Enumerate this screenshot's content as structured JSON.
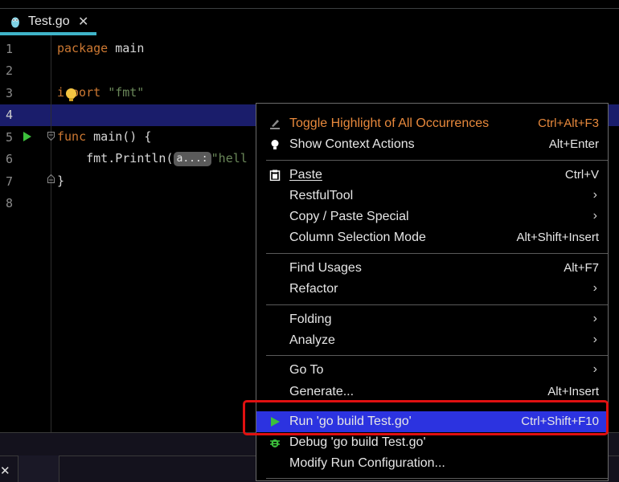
{
  "tab": {
    "name": "Test.go",
    "close": "✕"
  },
  "editor": {
    "line_numbers": [
      "1",
      "2",
      "3",
      "4",
      "5",
      "6",
      "7",
      "8"
    ],
    "code": {
      "l1_kw": "package",
      "l1_rest": " main",
      "l3_a": "i",
      "l3_b": "port ",
      "l3_str": "\"fmt\"",
      "l5_kw": "func",
      "l5_rest": " main() {",
      "l6_a": "    fmt.Println(",
      "l6_hint": "a...:",
      "l6_str": "\"hell",
      "l7": "}"
    }
  },
  "menu": {
    "items": [
      {
        "label": "Toggle Highlight of All Occurrences",
        "shortcut": "Ctrl+Alt+F3"
      },
      {
        "label": "Show Context Actions",
        "shortcut": "Alt+Enter"
      },
      {
        "label": "Paste",
        "shortcut": "Ctrl+V"
      },
      {
        "label": "RestfulTool",
        "arrow": "›"
      },
      {
        "label": "Copy / Paste Special",
        "arrow": "›"
      },
      {
        "label": "Column Selection Mode",
        "shortcut": "Alt+Shift+Insert"
      },
      {
        "label": "Find Usages",
        "shortcut": "Alt+F7"
      },
      {
        "label": "Refactor",
        "arrow": "›"
      },
      {
        "label": "Folding",
        "arrow": "›"
      },
      {
        "label": "Analyze",
        "arrow": "›"
      },
      {
        "label": "Go To",
        "arrow": "›"
      },
      {
        "label": "Generate...",
        "shortcut": "Alt+Insert"
      },
      {
        "label": "Run 'go build Test.go'",
        "shortcut": "Ctrl+Shift+F10"
      },
      {
        "label": "Debug 'go build Test.go'"
      },
      {
        "label": "Modify Run Configuration..."
      }
    ]
  },
  "bottom": {
    "close": "✕"
  },
  "colors": {
    "accent_tab": "#3fb4c9",
    "selected": "#2c33e0",
    "highlight_red": "#e01010",
    "keyword": "#cc7832",
    "string": "#6a8759"
  }
}
